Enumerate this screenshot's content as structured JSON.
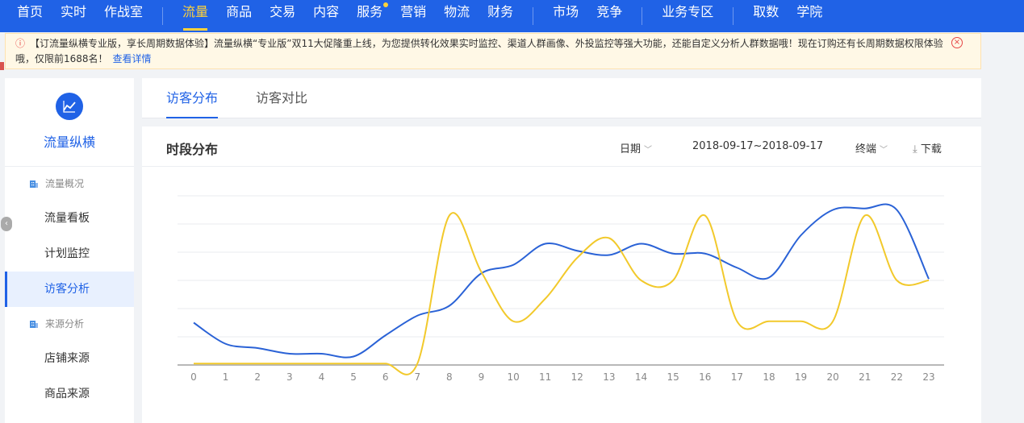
{
  "nav": {
    "groups": [
      [
        "首页",
        "实时",
        "作战室"
      ],
      [
        "流量",
        "商品",
        "交易",
        "内容",
        "服务",
        "营销",
        "物流",
        "财务"
      ],
      [
        "市场",
        "竞争"
      ],
      [
        "业务专区"
      ],
      [
        "取数",
        "学院"
      ]
    ],
    "active": "流量",
    "dot_item": "服务"
  },
  "notice": {
    "text": "【订流量纵横专业版，享长周期数据体验】流量纵横“专业版”双11大促隆重上线，为您提供转化效果实时监控、渠道人群画像、外投监控等强大功能，还能自定义分析人群数据哦！现在订购还有长周期数据权限体验哦，仅限前1688名！",
    "link": "查看详情"
  },
  "sidebar": {
    "title": "流量纵横",
    "sections": [
      {
        "label": "流量概况",
        "items": [
          "流量看板",
          "计划监控",
          "访客分析"
        ]
      },
      {
        "label": "来源分析",
        "items": [
          "店铺来源",
          "商品来源"
        ]
      }
    ],
    "active_item": "访客分析"
  },
  "tabs": [
    "访客分布",
    "访客对比"
  ],
  "active_tab": "访客分布",
  "panel": {
    "title": "时段分布",
    "date_label": "日期",
    "date_range": "2018-09-17~2018-09-17",
    "device_label": "终端",
    "download_label": "下载"
  },
  "colors": {
    "brand": "#2062e6",
    "accent": "#ffd23a",
    "series_a": "#2a62d6",
    "series_b": "#f2c92b"
  },
  "chart_data": {
    "type": "line",
    "x": [
      0,
      1,
      2,
      3,
      4,
      5,
      6,
      7,
      8,
      9,
      10,
      11,
      12,
      13,
      14,
      15,
      16,
      17,
      18,
      19,
      20,
      21,
      22,
      23
    ],
    "ylim": [
      0,
      6
    ],
    "grid": true,
    "series": [
      {
        "color": "#2a62d6",
        "values": [
          1.5,
          0.75,
          0.6,
          0.4,
          0.4,
          0.3,
          1.05,
          1.75,
          2.1,
          3.25,
          3.55,
          4.3,
          4.05,
          3.9,
          4.3,
          3.95,
          3.95,
          3.45,
          3.1,
          4.6,
          5.5,
          5.55,
          5.5,
          3.05
        ]
      },
      {
        "color": "#f2c92b",
        "values": [
          0.05,
          0.05,
          0.05,
          0.05,
          0.05,
          0.05,
          0.05,
          0.05,
          5.3,
          3.3,
          1.55,
          2.35,
          3.8,
          4.5,
          3.0,
          3.0,
          5.3,
          1.55,
          1.55,
          1.55,
          1.55,
          5.3,
          3.0,
          3.0
        ]
      }
    ]
  }
}
